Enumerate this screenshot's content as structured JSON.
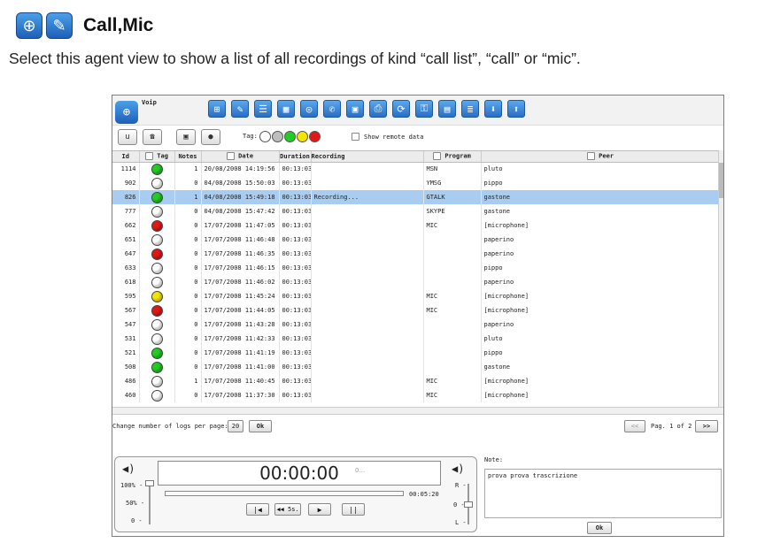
{
  "header": {
    "title": "Call,Mic",
    "globe_icon": "globe-icon",
    "edit_icon": "pencil-icon"
  },
  "description": "Select this agent view to show a list of all recordings of kind “call list”, “call” or “mic”.",
  "app": {
    "toolbar_label": "Voip",
    "toolbar_icons": [
      "hierarchy-icon",
      "edit-icon",
      "contact-icon",
      "grid-icon",
      "globe-icon",
      "chat-icon",
      "screen-icon",
      "printer-icon",
      "sync-icon",
      "lock-icon",
      "document-icon",
      "list-icon",
      "download-icon",
      "upload-icon"
    ],
    "small_buttons": [
      "u",
      "",
      "",
      ""
    ],
    "tag_label": "Tag:",
    "tag_colors": [
      "#ffffff",
      "#bdbdbd",
      "#22cc22",
      "#f2e600",
      "#e01818"
    ],
    "show_remote": "Show remote data",
    "columns": {
      "id": "Id",
      "tag": "Tag",
      "notes": "Notes",
      "date": "Date",
      "duration": "Duration",
      "recording": "Recording",
      "program": "Program",
      "peer": "Peer"
    },
    "rows": [
      {
        "id": "1114",
        "tag": "green",
        "notes": "1",
        "date": "20/08/2008 14:19:56",
        "duration": "00:13:03",
        "recording": "",
        "program": "MSN",
        "peer": "pluto"
      },
      {
        "id": "902",
        "tag": "white",
        "notes": "0",
        "date": "04/08/2008 15:50:03",
        "duration": "00:13:03",
        "recording": "",
        "program": "YMSG",
        "peer": "pippo"
      },
      {
        "id": "826",
        "tag": "green",
        "notes": "1",
        "date": "04/08/2008 15:49:18",
        "duration": "00:13:03",
        "recording": "Recording...",
        "program": "GTALK",
        "peer": "gastone",
        "selected": true
      },
      {
        "id": "777",
        "tag": "white",
        "notes": "0",
        "date": "04/08/2008 15:47:42",
        "duration": "00:13:03",
        "recording": "",
        "program": "SKYPE",
        "peer": "gastone"
      },
      {
        "id": "662",
        "tag": "red",
        "notes": "0",
        "date": "17/07/2008 11:47:05",
        "duration": "00:13:03",
        "recording": "",
        "program": "MIC",
        "peer": "[microphone]"
      },
      {
        "id": "651",
        "tag": "white",
        "notes": "0",
        "date": "17/07/2008 11:46:48",
        "duration": "00:13:03",
        "recording": "",
        "program": "",
        "peer": "paperino"
      },
      {
        "id": "647",
        "tag": "red",
        "notes": "0",
        "date": "17/07/2008 11:46:35",
        "duration": "00:13:03",
        "recording": "",
        "program": "",
        "peer": "paperino"
      },
      {
        "id": "633",
        "tag": "white",
        "notes": "0",
        "date": "17/07/2008 11:46:15",
        "duration": "00:13:03",
        "recording": "",
        "program": "",
        "peer": "pippo"
      },
      {
        "id": "618",
        "tag": "white",
        "notes": "0",
        "date": "17/07/2008 11:46:02",
        "duration": "00:13:03",
        "recording": "",
        "program": "",
        "peer": "paperino"
      },
      {
        "id": "595",
        "tag": "yellow",
        "notes": "0",
        "date": "17/07/2008 11:45:24",
        "duration": "00:13:03",
        "recording": "",
        "program": "MIC",
        "peer": "[microphone]"
      },
      {
        "id": "567",
        "tag": "red",
        "notes": "0",
        "date": "17/07/2008 11:44:05",
        "duration": "00:13:03",
        "recording": "",
        "program": "MIC",
        "peer": "[microphone]"
      },
      {
        "id": "547",
        "tag": "white",
        "notes": "0",
        "date": "17/07/2008 11:43:28",
        "duration": "00:13:03",
        "recording": "",
        "program": "",
        "peer": "paperino"
      },
      {
        "id": "531",
        "tag": "white",
        "notes": "0",
        "date": "17/07/2008 11:42:33",
        "duration": "00:13:03",
        "recording": "",
        "program": "",
        "peer": "pluto"
      },
      {
        "id": "521",
        "tag": "green",
        "notes": "0",
        "date": "17/07/2008 11:41:19",
        "duration": "00:13:03",
        "recording": "",
        "program": "",
        "peer": "pippo"
      },
      {
        "id": "508",
        "tag": "green",
        "notes": "0",
        "date": "17/07/2008 11:41:00",
        "duration": "00:13:03",
        "recording": "",
        "program": "",
        "peer": "gastone"
      },
      {
        "id": "486",
        "tag": "white",
        "notes": "1",
        "date": "17/07/2008 11:40:45",
        "duration": "00:13:03",
        "recording": "",
        "program": "MIC",
        "peer": "[microphone]"
      },
      {
        "id": "460",
        "tag": "white",
        "notes": "0",
        "date": "17/07/2008 11:37:30",
        "duration": "00:13:03",
        "recording": "",
        "program": "MIC",
        "peer": "[microphone]"
      }
    ],
    "pager": {
      "label": "Change number of logs per page:",
      "value": "20",
      "ok": "Ok",
      "prev": "<<",
      "page": "Pag. 1 of 2",
      "next": ">>"
    },
    "player": {
      "time": "00:00:00",
      "time_sub": "0...",
      "total": "00:05:20",
      "vol100": "100% -",
      "vol50": "50% -",
      "vol0": "0 -",
      "r": "R -",
      "zero": "0 -",
      "l": "L -",
      "btn_start": "|◀",
      "btn_back": "◀◀ 5s.",
      "btn_play": "▶",
      "btn_pause": "||"
    },
    "note": {
      "label": "Note:",
      "text": "prova prova trascrizione",
      "ok": "Ok"
    }
  },
  "tag_map": {
    "green": "#22cc22",
    "white": "#ffffff",
    "red": "#e01818",
    "yellow": "#f2e600"
  }
}
